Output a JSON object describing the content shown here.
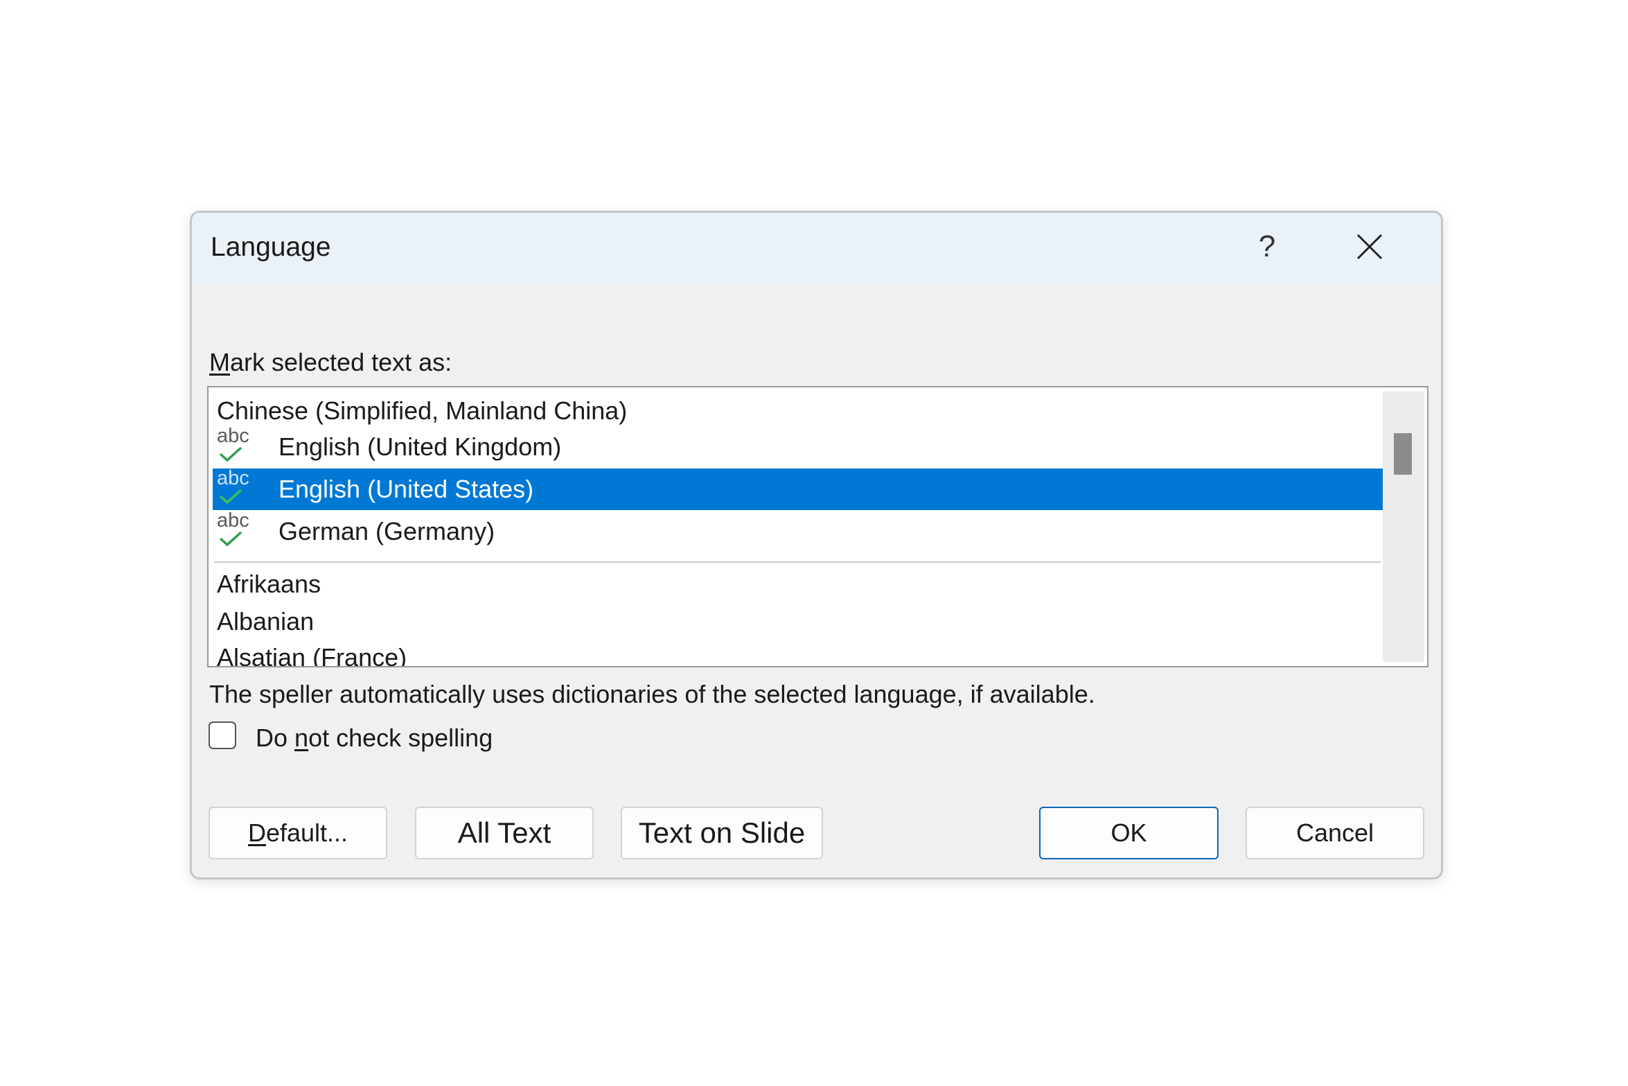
{
  "dialog": {
    "title": "Language",
    "help_label": "?",
    "close_icon": "close-icon"
  },
  "mark_label": {
    "accelerator": "M",
    "rest": "ark selected text as:"
  },
  "list": {
    "items": [
      {
        "label": "Chinese (Simplified, Mainland China)",
        "spellcheck": false,
        "selected": false
      },
      {
        "label": "English (United Kingdom)",
        "spellcheck": true,
        "selected": false
      },
      {
        "label": "English (United States)",
        "spellcheck": true,
        "selected": true
      },
      {
        "label": "German (Germany)",
        "spellcheck": true,
        "selected": false
      },
      {
        "label": "Afrikaans",
        "spellcheck": false,
        "selected": false
      },
      {
        "label": "Albanian",
        "spellcheck": false,
        "selected": false
      },
      {
        "label": "Alsatian (France)",
        "spellcheck": false,
        "selected": false
      }
    ],
    "spell_icon_text": "abc",
    "selected_color": "#0078d4",
    "check_color": "#2e9e4e"
  },
  "info_text": "The speller automatically uses dictionaries of the selected language, if available.",
  "no_spell_check": {
    "checked": false,
    "before": "Do ",
    "accelerator": "n",
    "after": "ot check spelling"
  },
  "buttons": {
    "default": {
      "accelerator": "D",
      "rest": "efault..."
    },
    "all_text": "All Text",
    "text_on_slide": "Text on Slide",
    "ok": "OK",
    "cancel": "Cancel"
  }
}
